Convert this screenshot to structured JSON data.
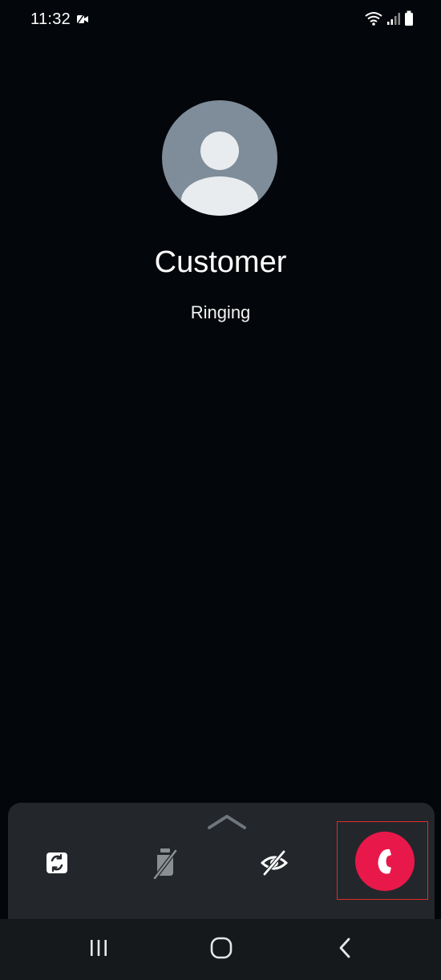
{
  "status_bar": {
    "time": "11:32",
    "icons": [
      "video-call-indicator-icon",
      "wifi-icon",
      "signal-icon",
      "battery-icon"
    ]
  },
  "call": {
    "caller_name": "Customer",
    "status": "Ringing",
    "avatar_icon": "person-placeholder-icon"
  },
  "actions": {
    "expand_icon": "chevron-up-icon",
    "buttons": [
      {
        "id": "switch-camera",
        "icon": "switch-camera-icon"
      },
      {
        "id": "mute",
        "icon": "mic-off-icon"
      },
      {
        "id": "video-off",
        "icon": "video-off-icon"
      },
      {
        "id": "end-call",
        "icon": "phone-icon"
      }
    ]
  },
  "navigation_bar": {
    "buttons": [
      "recent-apps-icon",
      "home-icon",
      "back-icon"
    ]
  },
  "colors": {
    "background": "#03060a",
    "panel": "#23272b",
    "end_call": "#e8184a",
    "avatar": "#7e8d99",
    "highlight": "#e02a2a"
  }
}
